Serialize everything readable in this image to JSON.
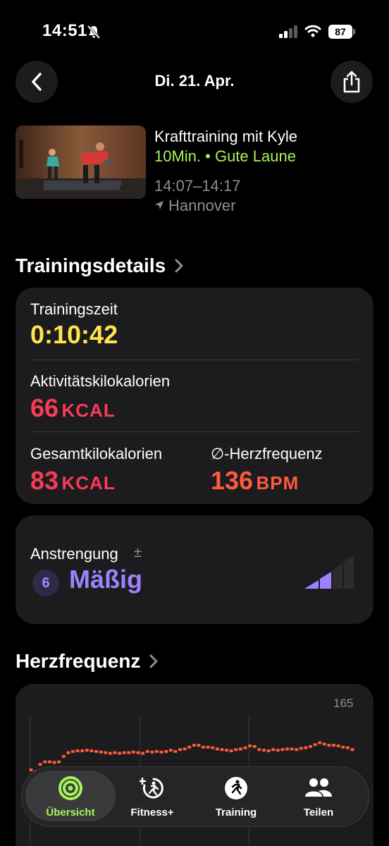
{
  "status": {
    "time": "14:51",
    "battery": "87"
  },
  "header": {
    "date": "Di. 21. Apr."
  },
  "workout": {
    "title": "Krafttraining mit Kyle",
    "subtitle": "10Min. • Gute Laune",
    "time_range": "14:07–14:17",
    "location": "Hannover"
  },
  "details": {
    "title": "Trainingsdetails",
    "training_time_label": "Trainingszeit",
    "training_time_value": "0:10:42",
    "active_kcal_label": "Aktivitätskilokalorien",
    "active_kcal_value": "66",
    "active_kcal_unit": "KCAL",
    "total_kcal_label": "Gesamtkilokalorien",
    "total_kcal_value": "83",
    "total_kcal_unit": "KCAL",
    "avg_hr_label": "∅-Herzfrequenz",
    "avg_hr_value": "136",
    "avg_hr_unit": "BPM"
  },
  "effort": {
    "label": "Anstrengung",
    "plusminus": "±",
    "score": "6",
    "level": "Mäßig",
    "level_fraction": 0.5
  },
  "heart": {
    "title": "Herzfrequenz",
    "max_label": "165"
  },
  "colors": {
    "yellow": "#ffe34d",
    "red": "#fa3a57",
    "orange": "#ff5a3c",
    "green": "#a8f25c",
    "purple": "#9d82ff"
  },
  "chart_data": {
    "type": "scatter",
    "title": "",
    "xlabel": "",
    "ylabel": "",
    "ylim": [
      80,
      165
    ],
    "tick_labels": [
      "165"
    ],
    "x": [
      0,
      1,
      2,
      3,
      4,
      5,
      6,
      7,
      8,
      9,
      10,
      11,
      12,
      13,
      14,
      15,
      16,
      17,
      18,
      19,
      20,
      21,
      22,
      23,
      24,
      25,
      26,
      27,
      28,
      29,
      30,
      31,
      32,
      33,
      34,
      35,
      36,
      37,
      38,
      39,
      40,
      41,
      42,
      43,
      44,
      45,
      46,
      47,
      48,
      49,
      50,
      51,
      52,
      53,
      54,
      55,
      56,
      57,
      58,
      59,
      60,
      61,
      62,
      63,
      64,
      65,
      66,
      67,
      68,
      69
    ],
    "values": [
      103,
      100,
      112,
      116,
      116,
      115,
      116,
      125,
      131,
      133,
      134,
      134,
      135,
      134,
      133,
      132,
      131,
      130,
      131,
      130,
      131,
      131,
      132,
      131,
      130,
      133,
      132,
      133,
      132,
      133,
      135,
      133,
      136,
      137,
      140,
      143,
      143,
      140,
      140,
      139,
      137,
      136,
      135,
      134,
      136,
      137,
      139,
      142,
      141,
      136,
      135,
      134,
      136,
      135,
      136,
      137,
      137,
      136,
      138,
      139,
      141,
      144,
      147,
      145,
      143,
      143,
      142,
      140,
      139,
      136
    ]
  },
  "tabs": [
    {
      "label": "Übersicht"
    },
    {
      "label": "Fitness+"
    },
    {
      "label": "Training"
    },
    {
      "label": "Teilen"
    }
  ]
}
